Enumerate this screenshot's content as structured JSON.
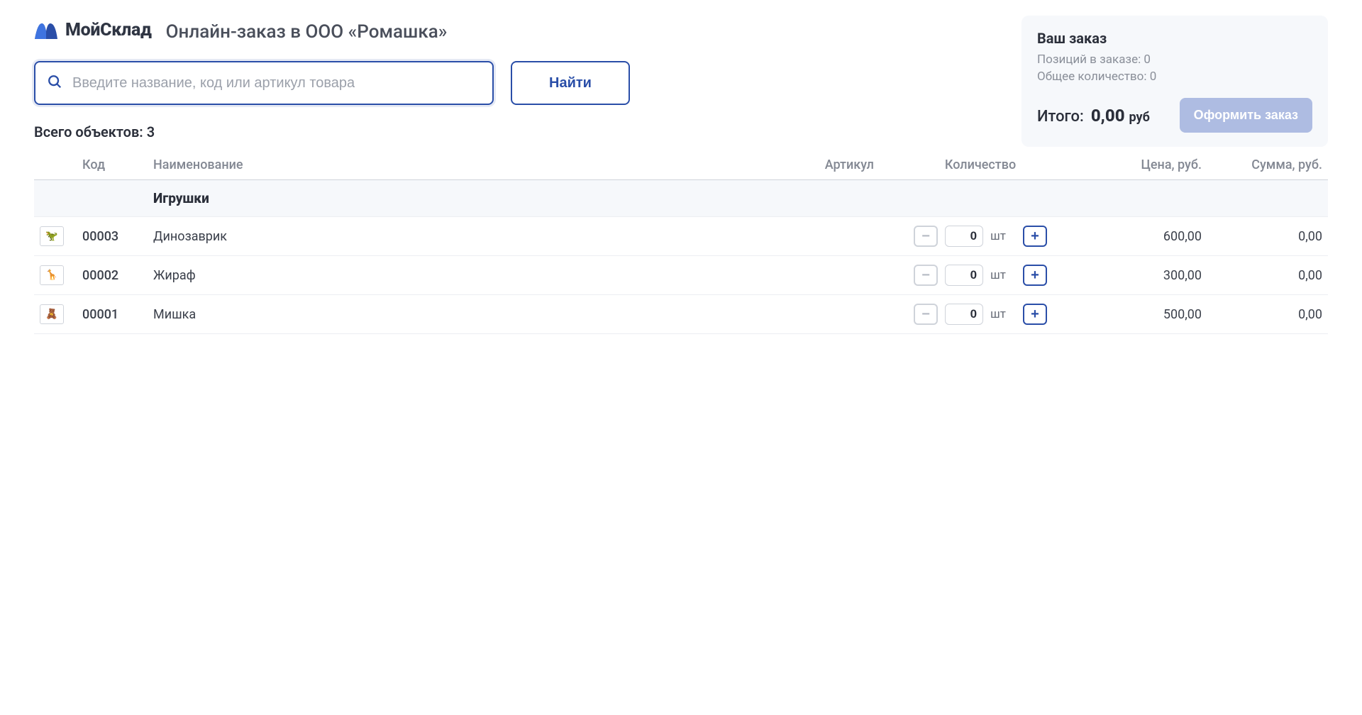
{
  "brand": "МойСклад",
  "page_title": "Онлайн-заказ в ООО «Ромашка»",
  "search": {
    "placeholder": "Введите название, код или артикул товара",
    "find_label": "Найти"
  },
  "order": {
    "title": "Ваш заказ",
    "positions_label": "Позиций в заказе:",
    "positions_value": "0",
    "total_qty_label": "Общее количество:",
    "total_qty_value": "0",
    "total_label": "Итого:",
    "total_value": "0,00",
    "currency": "руб",
    "checkout_label": "Оформить заказ"
  },
  "list": {
    "total_label": "Всего объектов:",
    "total_value": "3",
    "columns": {
      "code": "Код",
      "name": "Наименование",
      "article": "Артикул",
      "qty": "Количество",
      "price": "Цена, руб.",
      "sum": "Сумма, руб."
    },
    "category": "Игрушки",
    "unit": "шт",
    "rows": [
      {
        "code": "00003",
        "name": "Динозаврик",
        "article": "",
        "qty": "0",
        "price": "600,00",
        "sum": "0,00",
        "thumb": "🦖"
      },
      {
        "code": "00002",
        "name": "Жираф",
        "article": "",
        "qty": "0",
        "price": "300,00",
        "sum": "0,00",
        "thumb": "🦒"
      },
      {
        "code": "00001",
        "name": "Мишка",
        "article": "",
        "qty": "0",
        "price": "500,00",
        "sum": "0,00",
        "thumb": "🧸"
      }
    ]
  }
}
